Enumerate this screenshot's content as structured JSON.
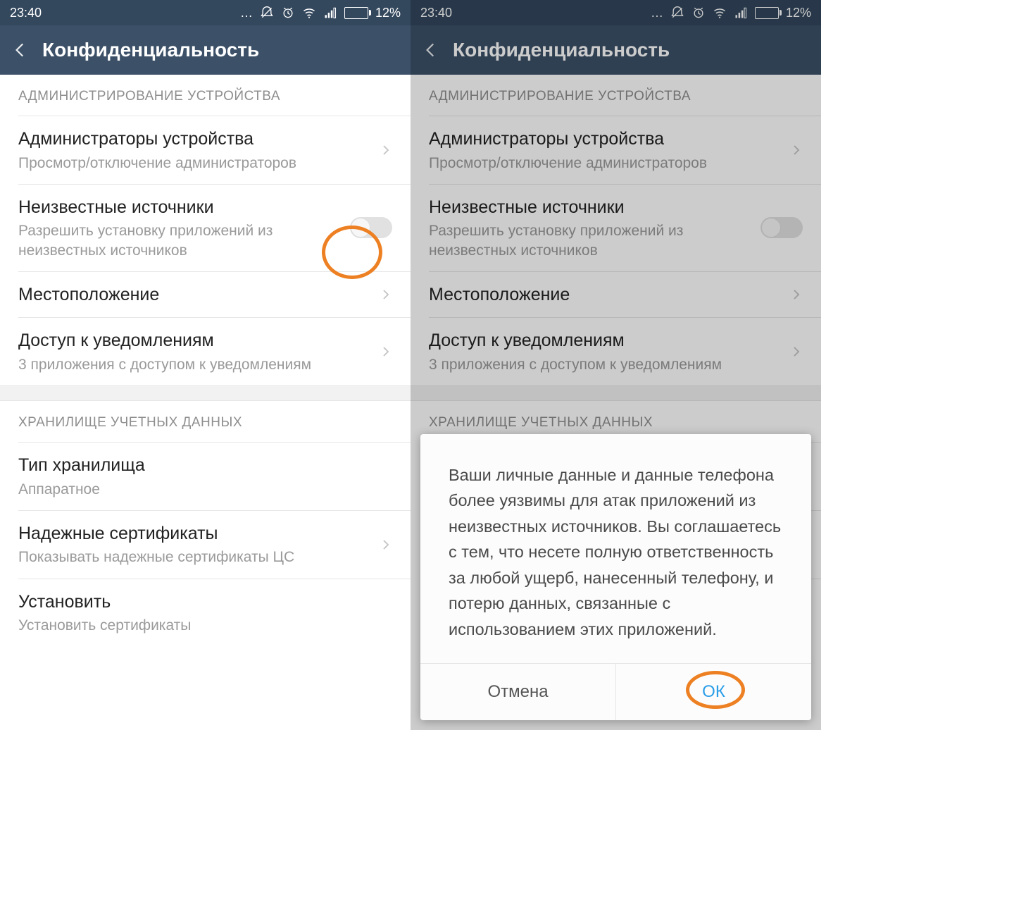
{
  "status": {
    "time": "23:40",
    "battery": "12%"
  },
  "header": {
    "title": "Конфиденциальность"
  },
  "section1": {
    "header": "АДМИНИСТРИРОВАНИЕ УСТРОЙСТВА"
  },
  "rows": {
    "admins": {
      "title": "Администраторы устройства",
      "sub": "Просмотр/отключение администраторов"
    },
    "unknown": {
      "title": "Неизвестные источники",
      "sub": "Разрешить установку приложений из неизвестных источников"
    },
    "location": {
      "title": "Местоположение"
    },
    "notif": {
      "title": "Доступ к уведомлениям",
      "sub": "3 приложения с доступом к уведомлениям"
    },
    "storage_type": {
      "title": "Тип хранилища",
      "sub": "Аппаратное"
    },
    "trusted": {
      "title": "Надежные сертификаты",
      "sub": "Показывать надежные сертификаты ЦС"
    },
    "install": {
      "title": "Установить",
      "sub": "Установить сертификаты"
    }
  },
  "section2": {
    "header": "ХРАНИЛИЩЕ УЧЕТНЫХ ДАННЫХ"
  },
  "dialog": {
    "text": "Ваши личные данные и данные телефона более уязвимы для атак приложений из неизвестных источников. Вы соглашаетесь с тем, что несете полную ответственность за любой ущерб, нанесенный телефону, и потерю данных, связанные с использованием этих приложений.",
    "cancel": "Отмена",
    "ok": "ОК"
  }
}
